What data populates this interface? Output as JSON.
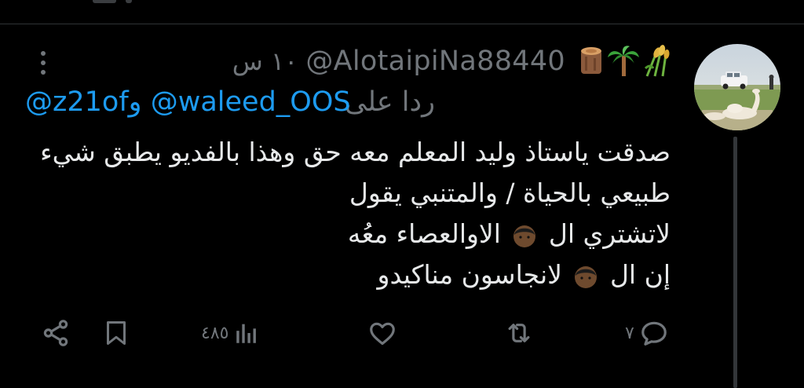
{
  "tweet": {
    "author_handle": "@AlotaipiNa88440",
    "name_emojis": [
      "log-icon",
      "palm-tree-icon",
      "rice-sheaf-icon"
    ],
    "time_ago": "١٠ س",
    "reply_prefix": "ردا على",
    "reply_to": [
      "@waleed_OOS",
      "@z21of"
    ],
    "reply_conjunction": "و",
    "body_lines": [
      "صدقت ياستاذ وليد المعلم معه حق وهذا بالفديو يطبق شيء",
      "طبيعي بالحياة / والمتنبي يقول",
      "لاتشتري ال",
      "الاوالعصاء معُه",
      "إن ال",
      "لانجاسون  مناكيدو"
    ]
  },
  "actions": {
    "reply_count": "٧",
    "retweet_count": "",
    "like_count": "",
    "views_count": "٤٨٥",
    "bookmark_count": "",
    "share_count": ""
  },
  "colors": {
    "background": "#000000",
    "text_primary": "#e7e9ea",
    "text_secondary": "#71767b",
    "accent": "#1d9bf0",
    "divider": "#2f3336"
  }
}
